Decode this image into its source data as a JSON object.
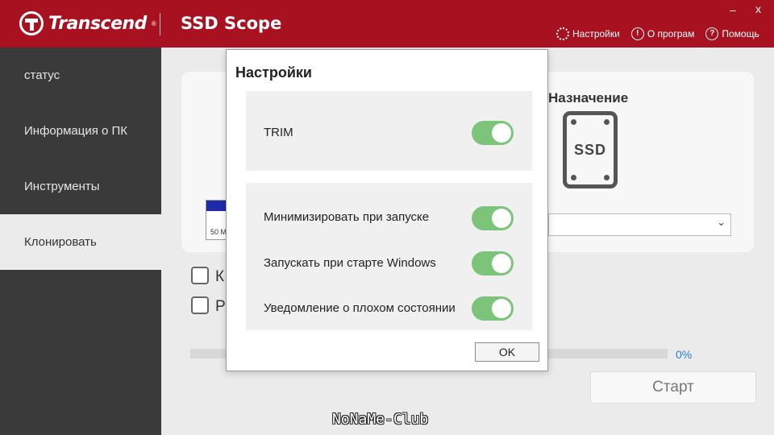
{
  "header": {
    "brand": "Transcend",
    "brand_reg": "®",
    "app_title": "SSD Scope",
    "links": [
      {
        "label": "Настройки",
        "icon": "gear-icon"
      },
      {
        "label": "О програм",
        "icon": "info-icon"
      },
      {
        "label": "Помощь",
        "icon": "help-icon"
      }
    ],
    "minimize": "–",
    "close": "x"
  },
  "sidebar": {
    "items": [
      {
        "label": "статус"
      },
      {
        "label": "Информация о ПК"
      },
      {
        "label": "Инструменты"
      },
      {
        "label": "Клонировать",
        "active": true
      }
    ]
  },
  "main": {
    "destination_label": "Назначение",
    "ssd_text": "SSD",
    "partition_label": "50 M",
    "checkbox1_label": "К",
    "checkbox2_label": "Р",
    "progress_percent": "0%",
    "progress_value": 0,
    "start_label": "Старт"
  },
  "dialog": {
    "title": "Настройки",
    "options": [
      {
        "label": "TRIM",
        "enabled": true
      },
      {
        "label": "Минимизировать при запуске",
        "enabled": true
      },
      {
        "label": "Запускать при старте Windows",
        "enabled": true
      },
      {
        "label": "Уведомление о плохом состоянии",
        "enabled": true
      }
    ],
    "ok_label": "OK"
  },
  "watermark": "NoNaMe-Club",
  "colors": {
    "header_bg": "#a8111f",
    "sidebar_bg": "#3a3a3a",
    "toggle_on": "#7cc47a",
    "progress_text": "#2a7bd5"
  }
}
